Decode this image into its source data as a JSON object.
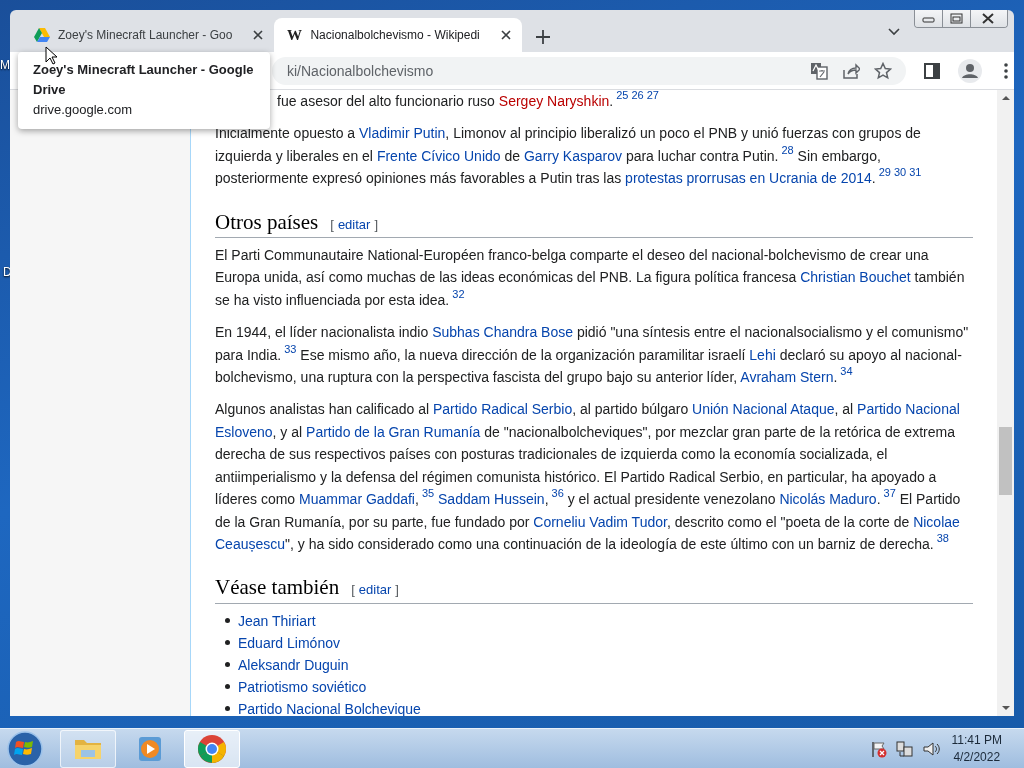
{
  "desktop": {
    "icon_labels": [
      {
        "text": "M"
      },
      {
        "text": "D"
      }
    ]
  },
  "tabs": [
    {
      "title": "Zoey's Minecraft Launcher - Goo",
      "selected": false,
      "icon": {
        "kind": "drive"
      }
    },
    {
      "title": "Nacionalbolchevismo - Wikipedi",
      "selected": true,
      "icon": {
        "kind": "letter",
        "text": "W"
      }
    }
  ],
  "tooltip": {
    "title": "Zoey's Minecraft Launcher - Google Drive",
    "url": "drive.google.com"
  },
  "address_bar": {
    "url": "ki/Nacionalbolchevismo"
  },
  "article": {
    "blocks": [
      {
        "kind": "paragraph",
        "indent": true,
        "runs": [
          {
            "kind": "text",
            "text": "fue asesor del alto funcionario ruso "
          },
          {
            "kind": "new_link",
            "text": "Sergey Naryshkin"
          },
          {
            "kind": "text",
            "text": "."
          },
          {
            "kind": "ref",
            "text": "25"
          },
          {
            "kind": "ref",
            "text": "26"
          },
          {
            "kind": "ref",
            "text": "27"
          }
        ]
      },
      {
        "kind": "paragraph",
        "indent": false,
        "runs": [
          {
            "kind": "text",
            "text": "Inicialmente opuesto a "
          },
          {
            "kind": "link",
            "text": "Vladimir Putin"
          },
          {
            "kind": "text",
            "text": ", Limonov al principio liberalizó un poco el PNB y unió fuerzas con grupos de izquierda y liberales en el "
          },
          {
            "kind": "link",
            "text": "Frente Cívico Unido"
          },
          {
            "kind": "text",
            "text": " de "
          },
          {
            "kind": "link",
            "text": "Garry Kasparov"
          },
          {
            "kind": "text",
            "text": " para luchar contra Putin."
          },
          {
            "kind": "ref",
            "text": "28"
          },
          {
            "kind": "text",
            "text": "  Sin embargo, posteriormente expresó opiniones más favorables a Putin tras las "
          },
          {
            "kind": "link",
            "text": "protestas prorrusas en Ucrania de 2014"
          },
          {
            "kind": "text",
            "text": "."
          },
          {
            "kind": "ref",
            "text": "29"
          },
          {
            "kind": "ref",
            "text": "30"
          },
          {
            "kind": "ref",
            "text": "31"
          }
        ]
      },
      {
        "kind": "heading",
        "title": "Otros países",
        "bracket_open": "[",
        "edit_label": "editar",
        "bracket_close": "]"
      },
      {
        "kind": "paragraph",
        "indent": false,
        "runs": [
          {
            "kind": "text",
            "text": "El Parti Communautaire National-Européen franco-belga comparte el deseo del nacional-bolchevismo de crear una Europa unida, así como muchas de las ideas económicas del PNB. La figura política francesa "
          },
          {
            "kind": "link",
            "text": "Christian Bouchet"
          },
          {
            "kind": "text",
            "text": " también se ha visto influenciada por esta idea."
          },
          {
            "kind": "ref",
            "text": "32"
          }
        ]
      },
      {
        "kind": "paragraph",
        "indent": false,
        "runs": [
          {
            "kind": "text",
            "text": "En 1944, el líder nacionalista indio "
          },
          {
            "kind": "link",
            "text": "Subhas Chandra Bose"
          },
          {
            "kind": "text",
            "text": " pidió \"una síntesis entre el nacionalsocialismo y el comunismo\" para India."
          },
          {
            "kind": "ref",
            "text": "33"
          },
          {
            "kind": "text",
            "text": "  Ese mismo año, la nueva dirección de la organización paramilitar israelí "
          },
          {
            "kind": "link",
            "text": "Lehi"
          },
          {
            "kind": "text",
            "text": " declaró su apoyo al nacional-bolchevismo, una ruptura con la perspectiva fascista del grupo bajo su anterior líder, "
          },
          {
            "kind": "link",
            "text": "Avraham Stern"
          },
          {
            "kind": "text",
            "text": "."
          },
          {
            "kind": "ref",
            "text": "34"
          }
        ]
      },
      {
        "kind": "paragraph",
        "indent": false,
        "runs": [
          {
            "kind": "text",
            "text": "Algunos analistas han calificado al "
          },
          {
            "kind": "link",
            "text": "Partido Radical Serbio"
          },
          {
            "kind": "text",
            "text": ", al partido búlgaro "
          },
          {
            "kind": "link",
            "text": "Unión Nacional Ataque"
          },
          {
            "kind": "text",
            "text": ", al "
          },
          {
            "kind": "link",
            "text": "Partido Nacional"
          },
          {
            "kind": "link",
            "text": "Esloveno"
          },
          {
            "kind": "text",
            "text": ", y al "
          },
          {
            "kind": "link",
            "text": "Partido de la Gran Rumanía"
          },
          {
            "kind": "text",
            "text": " de \"nacionalbolcheviques\", por mezclar gran parte de la retórica de extrema derecha de sus respectivos países con posturas tradicionales de izquierda como la economía socializada, el antiimperialismo y la defensa del régimen comunista histórico. El Partido Radical Serbio, en particular, ha apoyado a líderes como "
          },
          {
            "kind": "link",
            "text": "Muammar Gaddafi"
          },
          {
            "kind": "text",
            "text": ","
          },
          {
            "kind": "ref",
            "text": "35"
          },
          {
            "kind": "link",
            "text": "Saddam Hussein"
          },
          {
            "kind": "text",
            "text": ","
          },
          {
            "kind": "ref",
            "text": "36"
          },
          {
            "kind": "text",
            "text": "  y el actual presidente venezolano "
          },
          {
            "kind": "link",
            "text": "Nicolás Maduro"
          },
          {
            "kind": "text",
            "text": "."
          },
          {
            "kind": "ref",
            "text": "37"
          },
          {
            "kind": "text",
            "text": "  El Partido de la Gran Rumanía, por su parte, fue fundado por "
          },
          {
            "kind": "link",
            "text": "Corneliu Vadim Tudor"
          },
          {
            "kind": "text",
            "text": ", descrito como el \"poeta de la corte de "
          },
          {
            "kind": "link",
            "text": "Nicolae"
          },
          {
            "kind": "link",
            "text": "Ceaușescu"
          },
          {
            "kind": "text",
            "text": "\", y ha sido considerado como una continuación de la ideología de este último con un barniz de derecha."
          },
          {
            "kind": "ref",
            "text": "38"
          }
        ]
      },
      {
        "kind": "heading",
        "title": "Véase también",
        "bracket_open": "[",
        "edit_label": "editar",
        "bracket_close": "]"
      },
      {
        "kind": "list",
        "items": [
          {
            "text": "Jean Thiriart"
          },
          {
            "text": "Eduard Limónov"
          },
          {
            "text": "Aleksandr Duguin"
          },
          {
            "text": "Patriotismo soviético"
          },
          {
            "text": "Partido Nacional Bolchevique"
          }
        ]
      }
    ]
  },
  "taskbar": {
    "items": [
      {
        "kind": "folder",
        "running": true,
        "selected": false
      },
      {
        "kind": "media",
        "running": false,
        "selected": false
      },
      {
        "kind": "chrome",
        "running": true,
        "selected": true
      }
    ],
    "clock": {
      "time": "11:41 PM",
      "date": "4/2/2022"
    }
  }
}
